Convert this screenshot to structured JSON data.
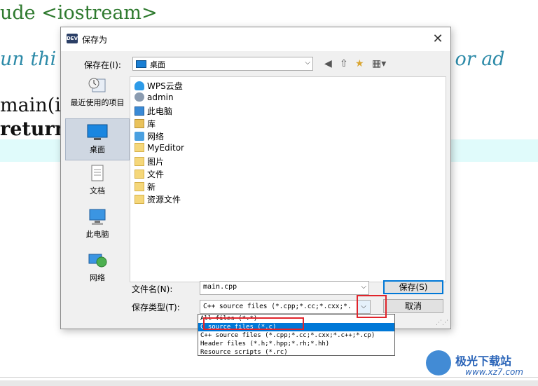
{
  "editor": {
    "line1": "ude <iostream>",
    "line2": "un thi",
    "line2_tail": "er or ad",
    "line3": "main(i",
    "line4": "return"
  },
  "dialog": {
    "title": "保存为",
    "save_in_label": "保存在(I):",
    "save_in_value": "桌面",
    "places": [
      {
        "label": "最近使用的项目",
        "icon": "recent-icon"
      },
      {
        "label": "桌面",
        "icon": "desktop-icon"
      },
      {
        "label": "文档",
        "icon": "documents-icon"
      },
      {
        "label": "此电脑",
        "icon": "computer-icon"
      },
      {
        "label": "网络",
        "icon": "network-icon"
      }
    ],
    "files": [
      {
        "name": "WPS云盘",
        "icon": "cloud-icon"
      },
      {
        "name": "admin",
        "icon": "user-icon"
      },
      {
        "name": "此电脑",
        "icon": "computer-icon"
      },
      {
        "name": "库",
        "icon": "library-icon"
      },
      {
        "name": "网络",
        "icon": "network-icon"
      },
      {
        "name": "MyEditor",
        "icon": "folder-icon"
      },
      {
        "name": "图片",
        "icon": "folder-icon"
      },
      {
        "name": "文件",
        "icon": "folder-icon"
      },
      {
        "name": "新",
        "icon": "folder-icon"
      },
      {
        "name": "资源文件",
        "icon": "folder-icon"
      }
    ],
    "filename_label": "文件名(N):",
    "filename_value": "main.cpp",
    "filetype_label": "保存类型(T):",
    "filetype_value": "C++ source files (*.cpp;*.cc;*.cxx;*.",
    "save_button": "保存(S)",
    "cancel_button": "取消",
    "filetype_options": [
      "All files (*.*)",
      "C source files (*.c)",
      "C++ source files (*.cpp;*.cc;*.cxx;*.c++;*.cp)",
      "Header files (*.h;*.hpp;*.rh;*.hh)",
      "Resource scripts (*.rc)"
    ],
    "selected_option_index": 1
  },
  "watermark": {
    "name": "极光下载站",
    "url": "www.xz7.com"
  }
}
